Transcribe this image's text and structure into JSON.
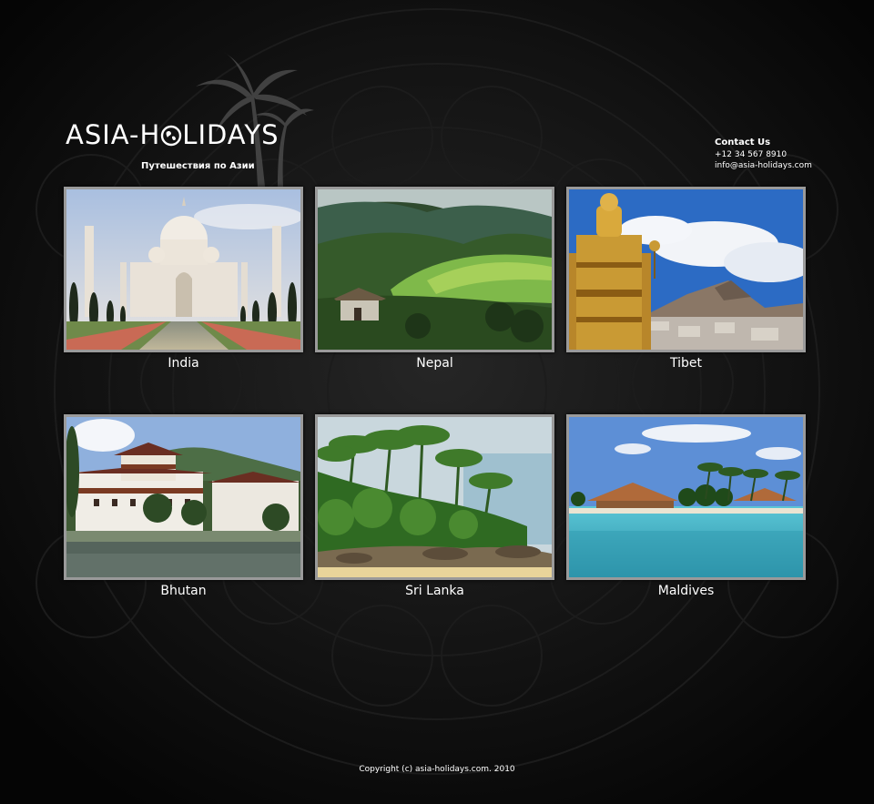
{
  "site": {
    "logo_text": "ASIA-HOLIDAYS",
    "logo_before": "ASIA-H",
    "logo_after": "LIDAYS",
    "tagline": "Путешествия по Азии"
  },
  "contact": {
    "title": "Contact Us",
    "phone": "+12 34 567 8910",
    "email": "info@asia-holidays.com"
  },
  "destinations": [
    {
      "label": "India"
    },
    {
      "label": "Nepal"
    },
    {
      "label": "Tibet"
    },
    {
      "label": "Bhutan"
    },
    {
      "label": "Sri Lanka"
    },
    {
      "label": "Maldives"
    }
  ],
  "footer": {
    "copyright": "Copyright (c) asia-holidays.com. 2010"
  },
  "colors": {
    "background": "#0b0b0b",
    "frame": "#9a9a9a"
  }
}
